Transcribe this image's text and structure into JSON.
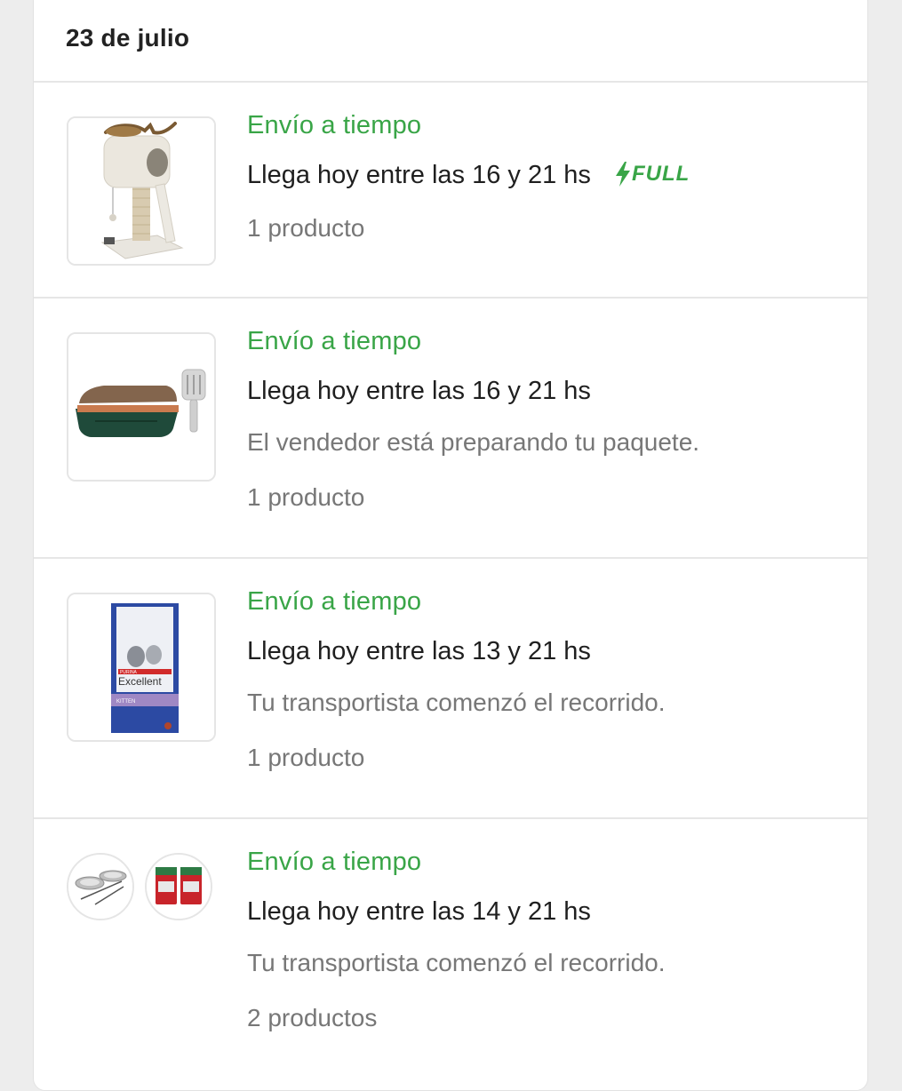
{
  "group": {
    "date": "23 de julio"
  },
  "shipments": [
    {
      "status": "Envío a tiempo",
      "eta": "Llega hoy entre las 16 y 21 hs",
      "badge": "FULL",
      "note": "",
      "count": "1 producto",
      "product": "cat-tree-image"
    },
    {
      "status": "Envío a tiempo",
      "eta": "Llega hoy entre las 16 y 21 hs",
      "note": "El vendedor está preparando tu paquete.",
      "count": "1 producto",
      "product": "litter-box-image"
    },
    {
      "status": "Envío a tiempo",
      "eta": "Llega hoy entre las 13 y 21 hs",
      "note": "Tu transportista comenzó el recorrido.",
      "count": "1 producto",
      "product": "cat-food-bag-image"
    },
    {
      "status": "Envío a tiempo",
      "eta": "Llega hoy entre las 14 y 21 hs",
      "note": "Tu transportista comenzó el recorrido.",
      "count": "2 productos",
      "product": "bowls-and-litter-bags-images"
    }
  ],
  "package_art": {
    "logo": "PURINA",
    "brand": "Excellent",
    "variant": "KITTEN"
  },
  "colors": {
    "status_green": "#39a547",
    "text_primary": "#1f1f1f",
    "text_secondary": "#777777",
    "background": "#ededed",
    "card": "#ffffff"
  }
}
